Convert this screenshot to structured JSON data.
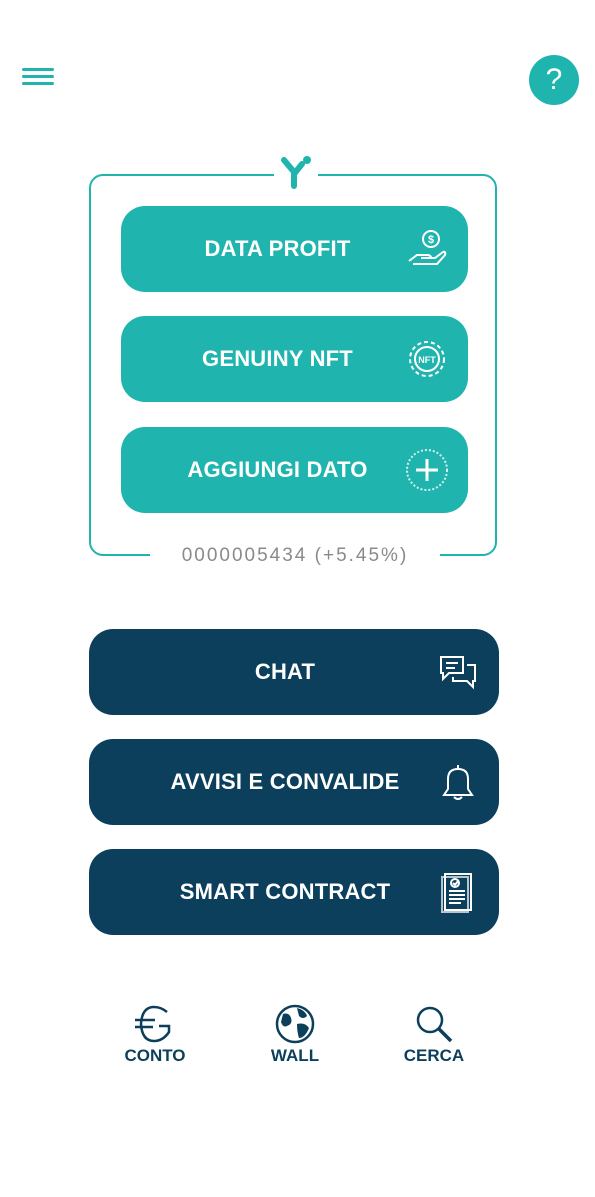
{
  "header": {
    "menu_icon": "hamburger-menu-icon",
    "help_label": "?"
  },
  "brand": {
    "logo_icon": "y-logo-icon"
  },
  "panel": {
    "buttons": [
      {
        "label": "DATA PROFIT",
        "icon": "hand-coin-icon"
      },
      {
        "label": "GENUINY NFT",
        "icon": "nft-gear-icon"
      },
      {
        "label": "AGGIUNGI DATO",
        "icon": "plus-circle-icon"
      }
    ],
    "counter": "0000005434 (+5.45%)"
  },
  "actions": [
    {
      "label": "CHAT",
      "icon": "chat-bubbles-icon"
    },
    {
      "label": "AVVISI E CONVALIDE",
      "icon": "bell-icon"
    },
    {
      "label": "SMART CONTRACT",
      "icon": "contract-document-icon"
    }
  ],
  "bottom_nav": [
    {
      "label": "CONTO",
      "icon": "euro-icon"
    },
    {
      "label": "WALL",
      "icon": "globe-icon"
    },
    {
      "label": "CERCA",
      "icon": "search-icon"
    }
  ],
  "colors": {
    "teal": "#1fb5ae",
    "navy": "#0b3f5c",
    "counter_gray": "#8a8a8a"
  }
}
